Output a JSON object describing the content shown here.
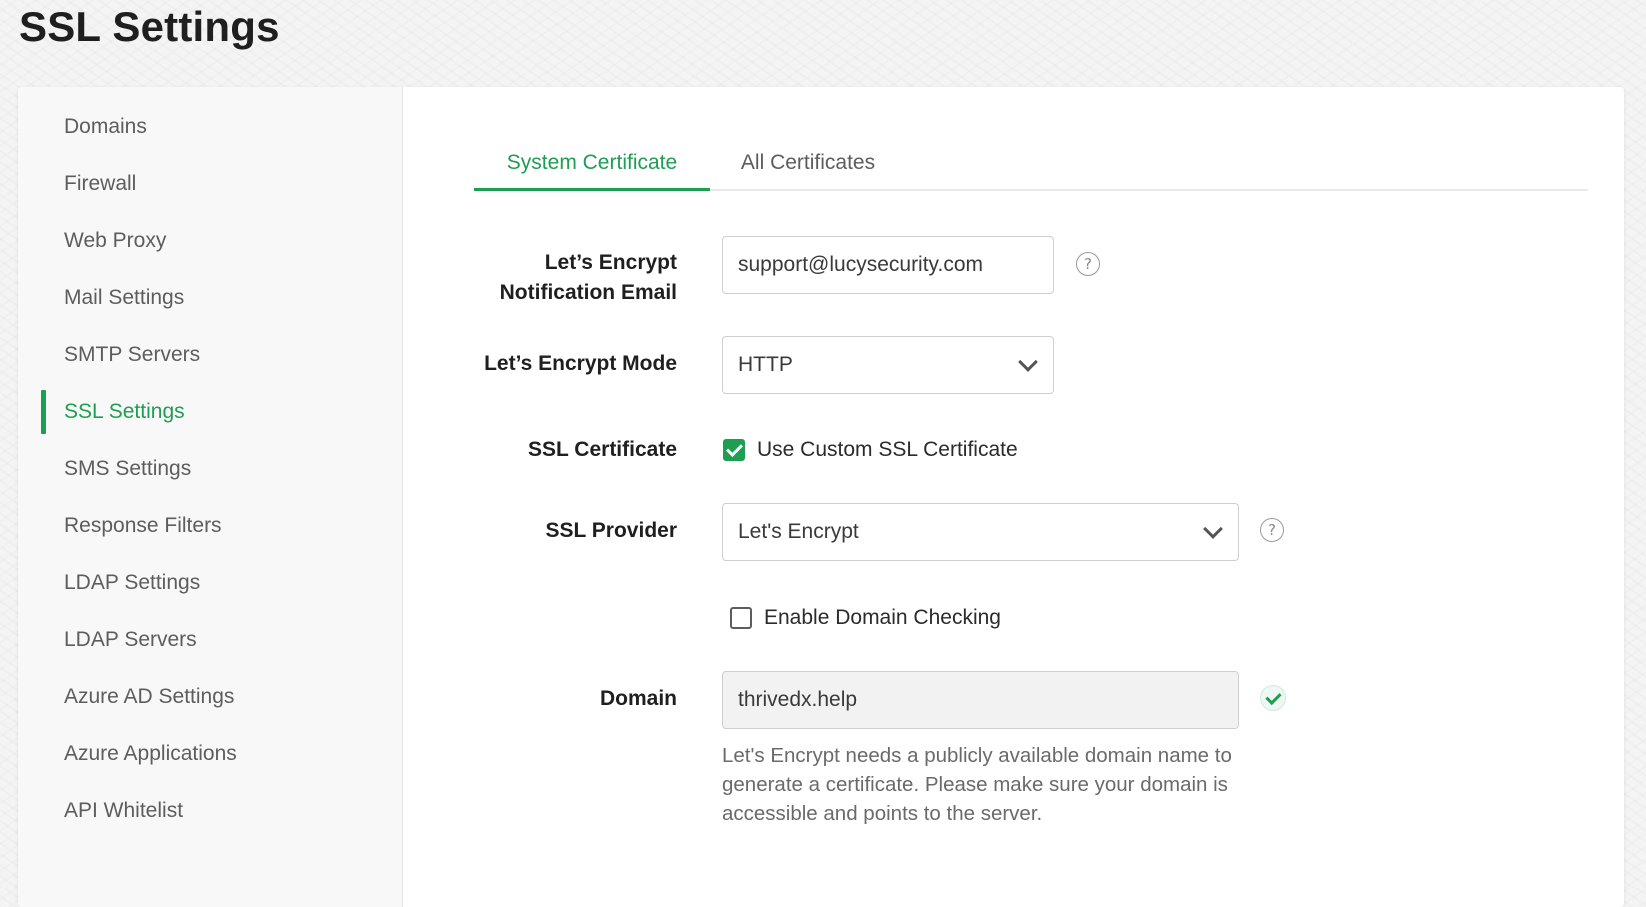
{
  "page": {
    "title": "SSL Settings"
  },
  "sidebar": {
    "items": [
      {
        "label": "Domains",
        "active": false
      },
      {
        "label": "Firewall",
        "active": false
      },
      {
        "label": "Web Proxy",
        "active": false
      },
      {
        "label": "Mail Settings",
        "active": false
      },
      {
        "label": "SMTP Servers",
        "active": false
      },
      {
        "label": "SSL Settings",
        "active": true
      },
      {
        "label": "SMS Settings",
        "active": false
      },
      {
        "label": "Response Filters",
        "active": false
      },
      {
        "label": "LDAP Settings",
        "active": false
      },
      {
        "label": "LDAP Servers",
        "active": false
      },
      {
        "label": "Azure AD Settings",
        "active": false
      },
      {
        "label": "Azure Applications",
        "active": false
      },
      {
        "label": "API Whitelist",
        "active": false
      }
    ]
  },
  "tabs": [
    {
      "label": "System Certificate",
      "active": true
    },
    {
      "label": "All Certificates",
      "active": false
    }
  ],
  "form": {
    "email": {
      "label_line1": "Let’s Encrypt",
      "label_line2": "Notification Email",
      "value": "support@lucysecurity.com",
      "help_icon": "?"
    },
    "mode": {
      "label": "Let’s Encrypt Mode",
      "value": "HTTP"
    },
    "ssl_certificate": {
      "label": "SSL Certificate",
      "checkbox_label": "Use Custom SSL Certificate",
      "checked": true
    },
    "provider": {
      "label": "SSL Provider",
      "value": "Let's Encrypt",
      "help_icon": "?"
    },
    "domain_checking": {
      "checkbox_label": "Enable Domain Checking",
      "checked": false
    },
    "domain": {
      "label": "Domain",
      "value": "thrivedx.help",
      "status_icon": "check-circle-icon"
    },
    "help_text": "Let's Encrypt needs a publicly available domain name to generate a certificate. Please make sure your domain is accessible and points to the server."
  },
  "colors": {
    "accent": "#1e9e52",
    "text": "#2b2b2b",
    "muted": "#5d5d5d"
  }
}
